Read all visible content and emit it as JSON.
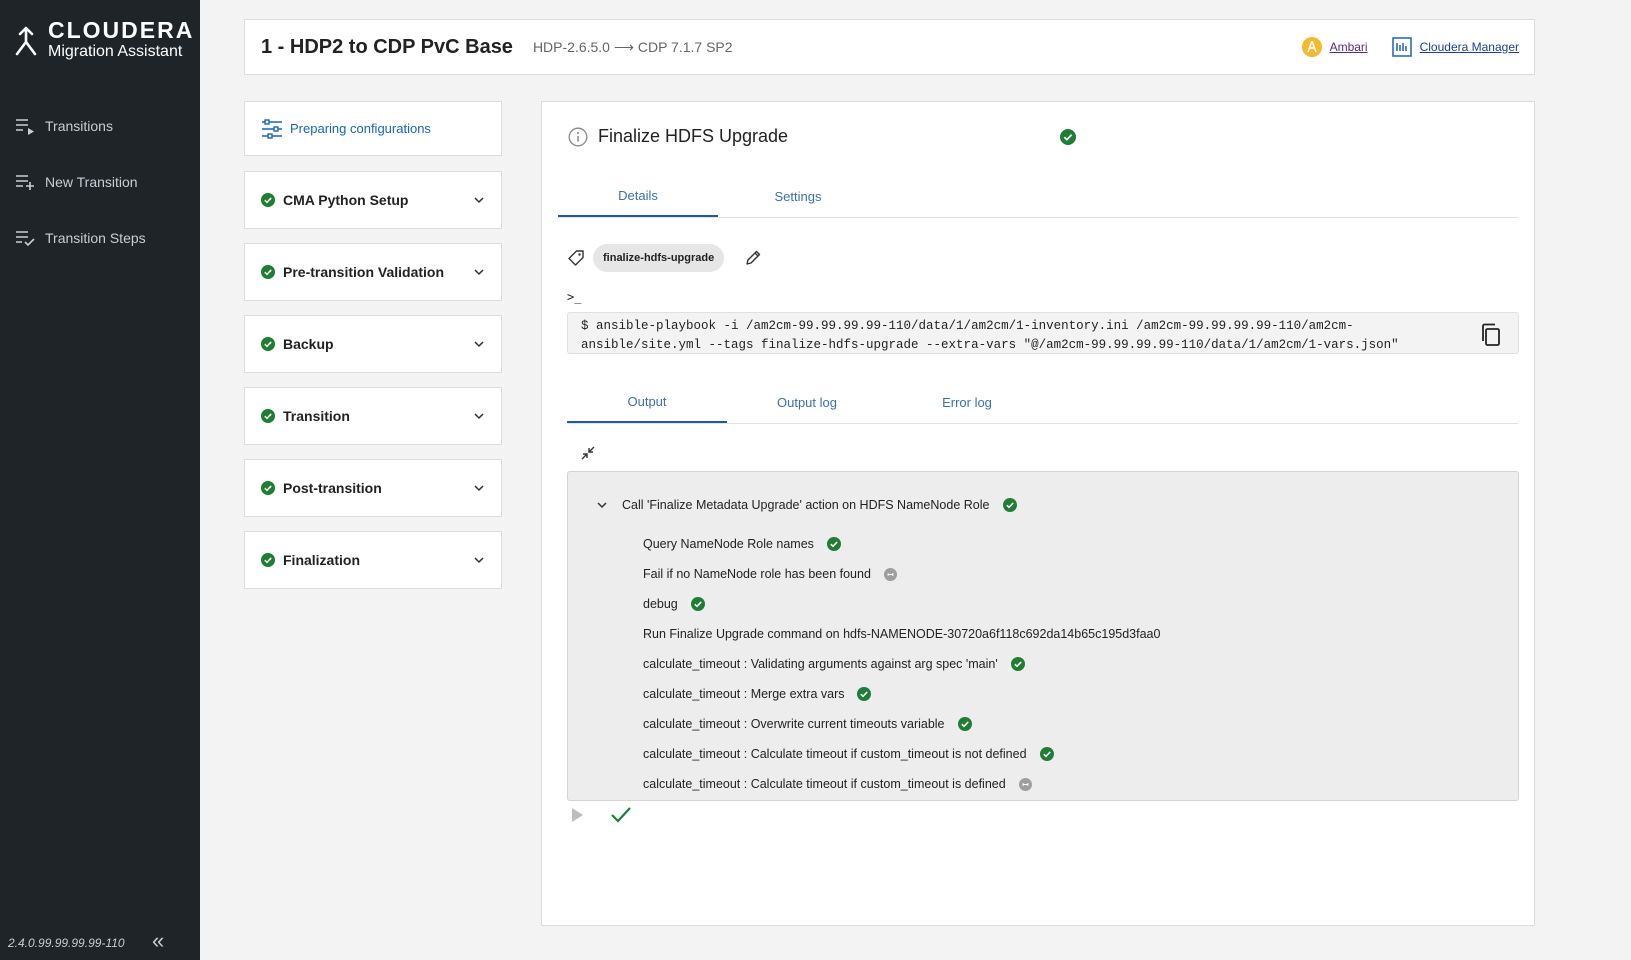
{
  "brand": {
    "name": "CLOUDERA",
    "subtitle": "Migration Assistant"
  },
  "sidebar": {
    "items": [
      {
        "label": "Transitions",
        "icon": "list-arrow-icon"
      },
      {
        "label": "New Transition",
        "icon": "list-add-icon"
      },
      {
        "label": "Transition Steps",
        "icon": "list-check-icon"
      }
    ],
    "version": "2.4.0.99.99.99.99-110"
  },
  "header": {
    "title": "1 - HDP2 to CDP PvC Base",
    "version_from": "HDP-2.6.5.0",
    "version_to": "CDP 7.1.7 SP2",
    "links": [
      {
        "label": "Ambari",
        "icon": "ambari-icon"
      },
      {
        "label": "Cloudera Manager",
        "icon": "cloudera-manager-icon"
      }
    ]
  },
  "steps": {
    "preparing": "Preparing configurations",
    "items": [
      {
        "label": "CMA Python Setup",
        "status": "success"
      },
      {
        "label": "Pre-transition Validation",
        "status": "success"
      },
      {
        "label": "Backup",
        "status": "success"
      },
      {
        "label": "Transition",
        "status": "success"
      },
      {
        "label": "Post-transition",
        "status": "success"
      },
      {
        "label": "Finalization",
        "status": "success"
      }
    ]
  },
  "panel": {
    "title": "Finalize HDFS Upgrade",
    "tabs": [
      "Details",
      "Settings"
    ],
    "active_tab": "Details",
    "tag": "finalize-hdfs-upgrade",
    "terminal_prompt": ">_",
    "command_line1": "$ ansible-playbook -i /am2cm-99.99.99.99-110/data/1/am2cm/1-inventory.ini /am2cm-99.99.99.99-110/am2cm-",
    "command_line2": "ansible/site.yml --tags finalize-hdfs-upgrade --extra-vars \"@/am2cm-99.99.99.99-110/data/1/am2cm/1-vars.json\"",
    "output_tabs": [
      "Output",
      "Output log",
      "Error log"
    ],
    "active_output_tab": "Output",
    "output": {
      "group_title": "Call 'Finalize Metadata Upgrade' action on HDFS NameNode Role",
      "group_status": "success",
      "tasks": [
        {
          "label": "Query NameNode Role names",
          "status": "success"
        },
        {
          "label": "Fail if no NameNode role has been found",
          "status": "skipped"
        },
        {
          "label": "debug",
          "status": "success"
        },
        {
          "label": "Run Finalize Upgrade command on hdfs-NAMENODE-30720a6f118c692da14b65c195d3faa0",
          "status": "none"
        },
        {
          "label": "calculate_timeout : Validating arguments against arg spec 'main'",
          "status": "success"
        },
        {
          "label": "calculate_timeout : Merge extra vars",
          "status": "success"
        },
        {
          "label": "calculate_timeout : Overwrite current timeouts variable",
          "status": "success"
        },
        {
          "label": "calculate_timeout : Calculate timeout if custom_timeout is not defined",
          "status": "success"
        },
        {
          "label": "calculate_timeout : Calculate timeout if custom_timeout is defined",
          "status": "skipped"
        }
      ]
    }
  },
  "colors": {
    "sidebar_bg": "#1f2429",
    "accent_blue": "#2457a8",
    "success_green": "#1e7e34",
    "skipped_grey": "#9e9e9e"
  }
}
